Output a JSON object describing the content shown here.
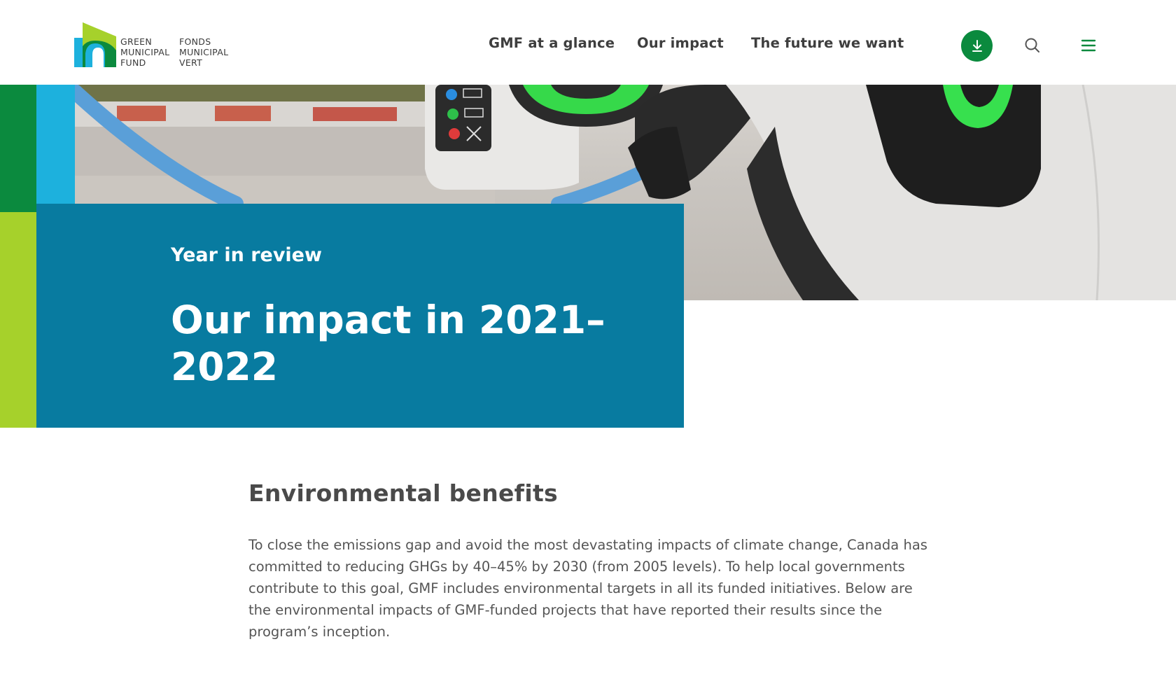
{
  "logo": {
    "en_lines": [
      "GREEN",
      "MUNICIPAL",
      "FUND"
    ],
    "fr_lines": [
      "FONDS",
      "MUNICIPAL",
      "VERT"
    ]
  },
  "nav": {
    "items": [
      {
        "label": "GMF at a glance"
      },
      {
        "label": "Our impact"
      },
      {
        "label": "The future we want"
      }
    ]
  },
  "header_actions": {
    "download_icon": "download-icon",
    "search_icon": "search-icon",
    "menu_icon": "hamburger-menu-icon"
  },
  "hero": {
    "eyebrow": "Year in review",
    "title": "Our impact in 2021–2022"
  },
  "section": {
    "heading": "Environmental benefits",
    "body": "To close the emissions gap and avoid the most devastating impacts of climate change, Canada has committed to reducing GHGs by 40–45% by 2030 (from 2005 levels). To help local governments contribute to this goal, GMF includes environmental targets in all its funded initiatives. Below are the environmental impacts of GMF-funded projects that have reported their results since the program’s inception."
  },
  "colors": {
    "brand_green": "#0b8a3e",
    "brand_lime": "#a6d12b",
    "brand_cyan": "#1db1dd",
    "hero_card_blue": "#087ba0"
  }
}
